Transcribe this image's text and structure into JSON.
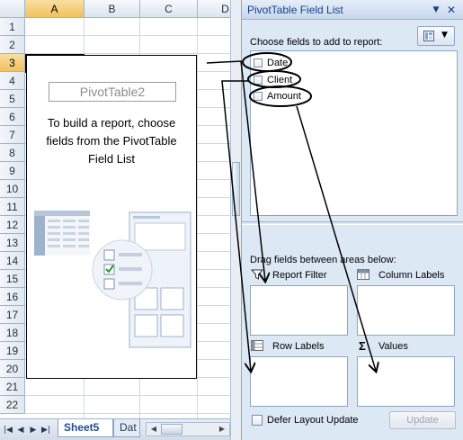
{
  "sheet": {
    "columns": [
      "A",
      "B",
      "C",
      "D"
    ],
    "selected_column": "A",
    "rows": [
      "1",
      "2",
      "3",
      "4",
      "5",
      "6",
      "7",
      "8",
      "9",
      "10",
      "11",
      "12",
      "13",
      "14",
      "15",
      "16",
      "17",
      "18",
      "19",
      "20",
      "21",
      "22"
    ],
    "selected_row": "3",
    "pivot": {
      "name": "PivotTable2",
      "instructions": "To build a report, choose fields from the PivotTable Field List"
    },
    "tabs": [
      "Sheet5",
      "Dat"
    ],
    "active_tab": "Sheet5"
  },
  "field_list": {
    "title": "PivotTable Field List",
    "choose_label": "Choose fields to add to report:",
    "fields": [
      {
        "name": "Date",
        "checked": false
      },
      {
        "name": "Client",
        "checked": false
      },
      {
        "name": "Amount",
        "checked": false
      }
    ],
    "drag_label": "Drag fields between areas below:",
    "areas": {
      "report_filter": "Report Filter",
      "column_labels": "Column Labels",
      "row_labels": "Row Labels",
      "values": "Values"
    },
    "defer_label": "Defer Layout Update",
    "defer_checked": false,
    "update_button": "Update"
  },
  "icons": {
    "close": "close-icon",
    "dropdown": "chevron-down-icon",
    "layout": "field-layout-icon",
    "filter": "funnel-icon",
    "columns": "column-labels-icon",
    "rows": "row-labels-icon",
    "values": "sigma-icon"
  },
  "colors": {
    "pane_background": "#dde8f5",
    "pane_title_text": "#15428b",
    "selected_header": "#f1c15f",
    "annotation": "#000000"
  }
}
